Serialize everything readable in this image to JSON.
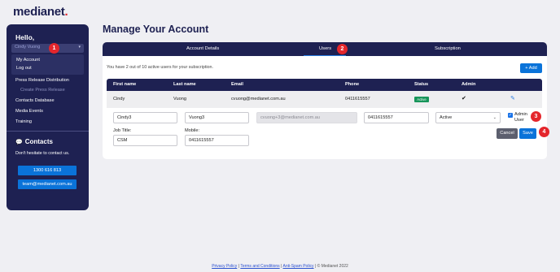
{
  "brand": {
    "name": "medianet",
    "dot": "."
  },
  "sidebar": {
    "greeting": "Hello,",
    "user_select_value": "Cindy Vuong",
    "dropdown": [
      "My Account",
      "Log out"
    ],
    "nav": [
      "Press Release Distribution",
      "Create Press Release",
      "Contacts Database",
      "Media Events",
      "Training"
    ],
    "contacts_title": "Contacts",
    "contacts_desc": "Don't hesitate to contact us.",
    "phone": "1300 616 813",
    "email": "team@medianet.com.au"
  },
  "page_title": "Manage Your Account",
  "tabs": [
    "Account Details",
    "Users",
    "Subscription"
  ],
  "active_tab": "Users",
  "usage_text": "You have 2 out of 10 active users for your subscription.",
  "add_button": "Add",
  "table": {
    "headers": [
      "First name",
      "Last name",
      "Email",
      "Phone",
      "Status",
      "Admin"
    ],
    "row": {
      "first": "Cindy",
      "last": "Vuong",
      "email": "cvuong@medianet.com.au",
      "phone": "0411615557",
      "status": "Active",
      "admin": "✔"
    }
  },
  "edit_form": {
    "first_name": "Cindy3",
    "last_name": "Vuong3",
    "email": "cvuong+3@medianet.com.au",
    "phone": "0411615557",
    "status": "Active",
    "admin_label": "Admin User",
    "job_title_label": "Job Title:",
    "job_title": "CSM",
    "mobile_label": "Mobile:",
    "mobile": "0411615557",
    "cancel": "Cancel",
    "save": "Save"
  },
  "badges": [
    "1",
    "2",
    "3",
    "4"
  ],
  "footer": {
    "privacy": "Privacy Policy",
    "terms": "Terms and Conditions",
    "antispam": "Anti-Spam Policy",
    "copyright": "© Medianet 2022",
    "sep": " | "
  },
  "colors": {
    "navy": "#1e2152",
    "accent": "#0a73d9",
    "badge": "#e4262c",
    "active_status": "#17955a"
  }
}
